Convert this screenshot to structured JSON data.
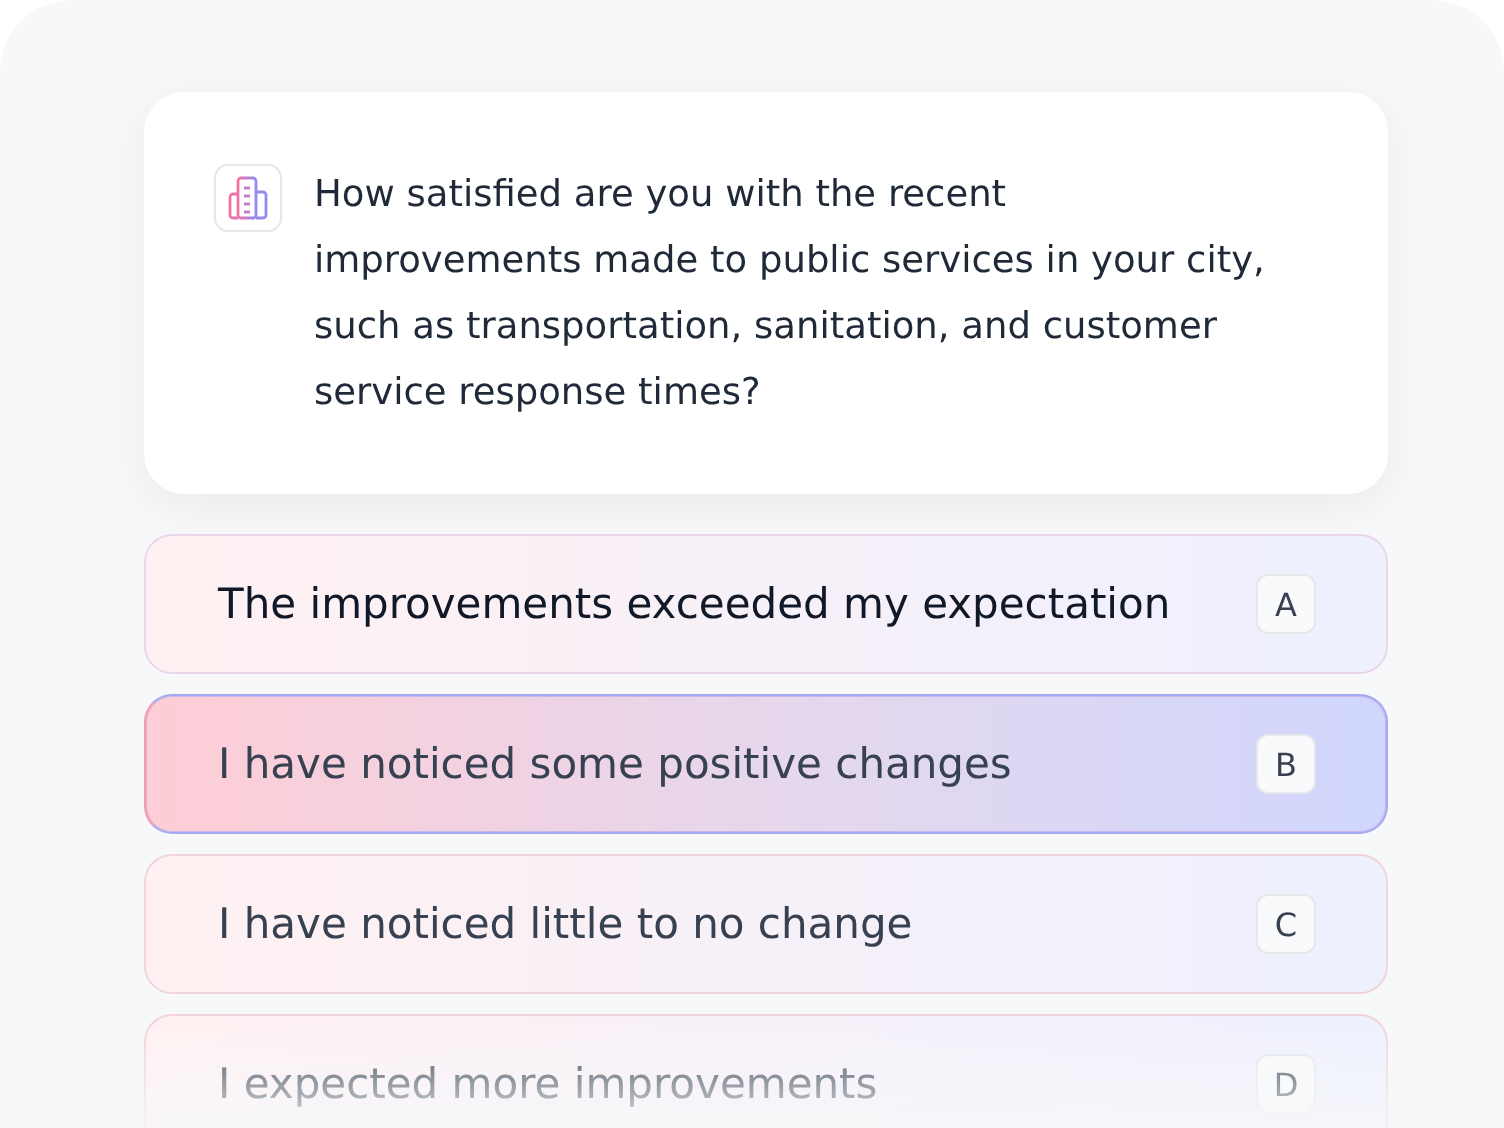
{
  "question": {
    "text": "How satisfied are you with the recent improvements made to public services in your city, such as transportation, sanitation, and customer service response times?"
  },
  "options": [
    {
      "label": "The improvements exceeded my expectation",
      "key": "A",
      "selected": false
    },
    {
      "label": "I have noticed some positive changes",
      "key": "B",
      "selected": true
    },
    {
      "label": "I have noticed little to no change",
      "key": "C",
      "selected": false
    },
    {
      "label": "I expected more improvements",
      "key": "D",
      "selected": false
    }
  ]
}
